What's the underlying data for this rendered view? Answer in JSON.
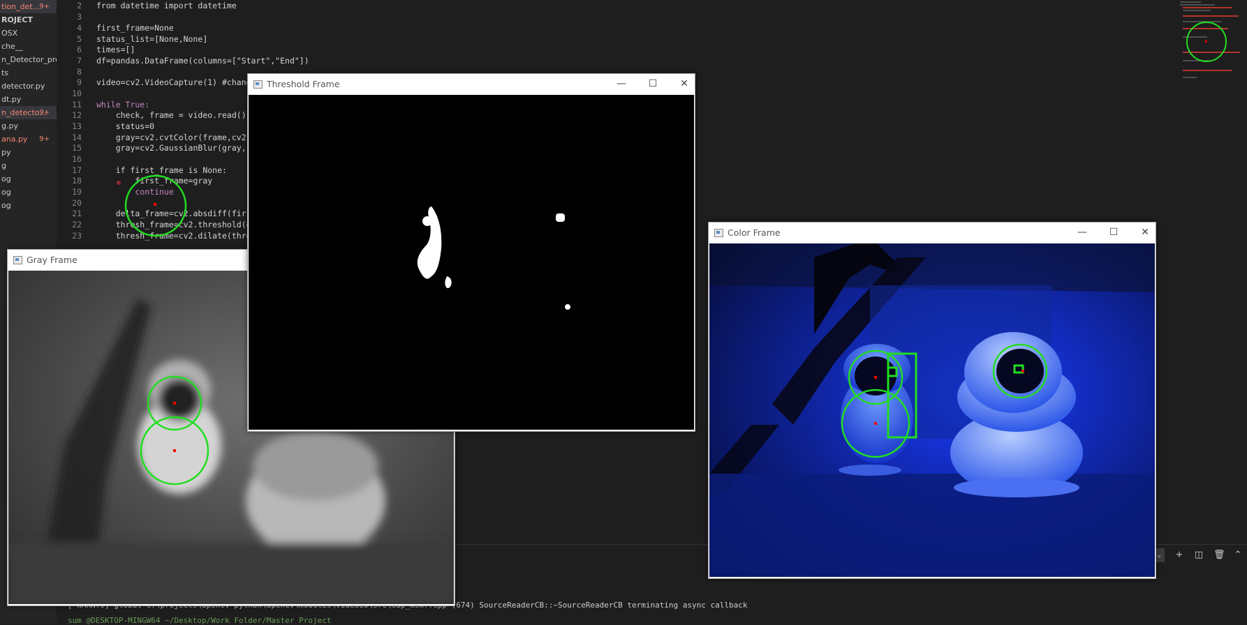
{
  "sidebar": {
    "items": [
      {
        "label": "tion_det...",
        "badge": "9+"
      },
      {
        "label": "ROJECT"
      },
      {
        "label": "OSX"
      },
      {
        "label": "che__"
      },
      {
        "label": "n_Detector_prot"
      },
      {
        "label": "ts"
      },
      {
        "label": "detector.py"
      },
      {
        "label": "dt.py"
      },
      {
        "label": "n_detecto...",
        "badge": "9+"
      },
      {
        "label": "g.py"
      },
      {
        "label": "ana.py",
        "badge": "9+"
      },
      {
        "label": "py"
      },
      {
        "label": "g"
      },
      {
        "label": "og"
      },
      {
        "label": "og"
      },
      {
        "label": "og"
      }
    ]
  },
  "editor": {
    "line_numbers": [
      "2",
      "3",
      "4",
      "5",
      "6",
      "7",
      "8",
      "9",
      "10",
      "11",
      "12",
      "13",
      "14",
      "15",
      "16",
      "17",
      "18",
      "19",
      "20",
      "21",
      "22",
      "23"
    ],
    "code": {
      "l2": "from datetime import datetime",
      "l4": "first_frame=None",
      "l5": "status_list=[None,None]",
      "l6": "times=[]",
      "l7": "df=pandas.DataFrame(columns=[\"Start\",\"End\"])",
      "l9": "video=cv2.VideoCapture(1) #change",
      "l11": "while True:",
      "l12": "    check, frame = video.read()",
      "l13": "    status=0",
      "l14": "    gray=cv2.cvtColor(frame,cv2.CO",
      "l15": "    gray=cv2.GaussianBlur(gray,(21",
      "l17": "    if first_frame is None:",
      "l18": "        first_frame=gray",
      "l19": "        continue",
      "l21": "    delta_frame=cv2.absdiff(first_",
      "l22": "    thresh_frame=cv2.threshold(del",
      "l23": "    thresh_frame=cv2.dilate(thresh"
    }
  },
  "terminal": {
    "log_line": "[ WARN:0] global C:\\projects\\opencv-python\\opencv\\modules\\videoio\\src\\cap_msmf.cpp (674) SourceReaderCB::~SourceReaderCB terminating async callback",
    "prompt_line": "sum @DESKTOP-MINGW64 ~/Desktop/Work Folder/Master Project"
  },
  "windows": {
    "gray": {
      "title": "Gray Frame"
    },
    "threshold": {
      "title": "Threshold Frame"
    },
    "color": {
      "title": "Color Frame"
    }
  },
  "colors": {
    "detection_green": "#22dd22",
    "centroid_red": "#ff0000",
    "color_frame_blue": "#1a3cff"
  }
}
